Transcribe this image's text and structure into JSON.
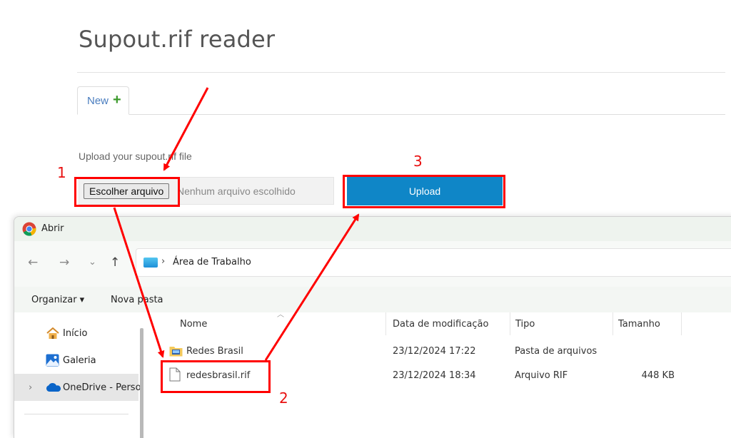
{
  "page": {
    "title": "Supout.rif reader",
    "tab_new_label": "New",
    "tab_new_plus": "+",
    "upload_label": "Upload your supout.rif file",
    "file_button_label": "Escolher arquivo",
    "file_status": "Nenhum arquivo escolhido",
    "upload_button_label": "Upload"
  },
  "dialog": {
    "title": "Abrir",
    "nav": {
      "back": "←",
      "forward": "→",
      "recent": "⌄",
      "up": "↑"
    },
    "address_separator": "›",
    "address_path": "Área de Trabalho",
    "toolbar": {
      "organize_label": "Organizar ▾",
      "new_folder_label": "Nova pasta"
    },
    "sidebar": [
      {
        "label": "Início",
        "icon": "home-icon"
      },
      {
        "label": "Galeria",
        "icon": "gallery-icon"
      },
      {
        "label": "OneDrive - Perso",
        "icon": "onedrive-icon",
        "expander": "›"
      }
    ],
    "columns": {
      "name": "Nome",
      "modified": "Data de modificação",
      "type": "Tipo",
      "size": "Tamanho"
    },
    "files": [
      {
        "name": "Redes Brasil",
        "modified": "23/12/2024 17:22",
        "type": "Pasta de arquivos",
        "size": "",
        "icon": "folder-icon"
      },
      {
        "name": "redesbrasil.rif",
        "modified": "23/12/2024 18:34",
        "type": "Arquivo RIF",
        "size": "448 KB",
        "icon": "file-icon"
      }
    ]
  },
  "annotations": {
    "step1": "1",
    "step2": "2",
    "step3": "3"
  },
  "colors": {
    "annotation": "#ff0000",
    "upload_button": "#0f86c7",
    "tab_link": "#4a7dbf",
    "plus": "#3c9a2c"
  }
}
